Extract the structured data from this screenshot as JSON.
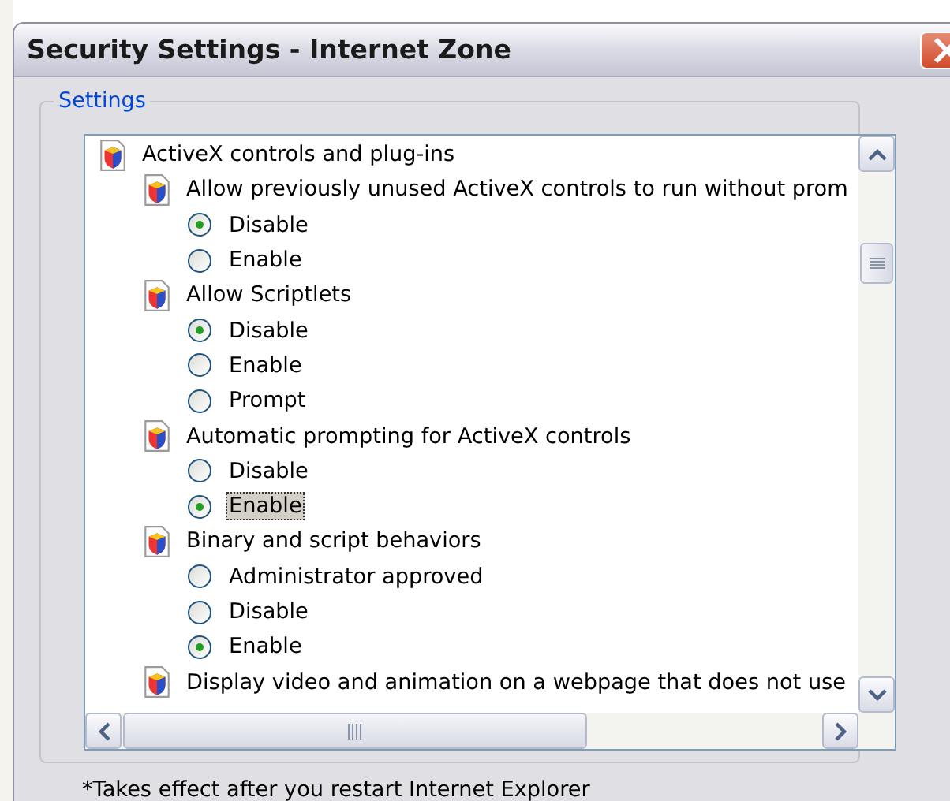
{
  "window": {
    "title": "Security Settings - Internet Zone"
  },
  "settings": {
    "label": "Settings",
    "items": [
      {
        "kind": "category",
        "label": "ActiveX controls and plug-ins",
        "children": [
          {
            "kind": "setting",
            "label": "Allow previously unused ActiveX controls to run without prom",
            "options": [
              {
                "label": "Disable",
                "selected": true,
                "focused": false
              },
              {
                "label": "Enable",
                "selected": false,
                "focused": false
              }
            ]
          },
          {
            "kind": "setting",
            "label": "Allow Scriptlets",
            "options": [
              {
                "label": "Disable",
                "selected": true,
                "focused": false
              },
              {
                "label": "Enable",
                "selected": false,
                "focused": false
              },
              {
                "label": "Prompt",
                "selected": false,
                "focused": false
              }
            ]
          },
          {
            "kind": "setting",
            "label": "Automatic prompting for ActiveX controls",
            "options": [
              {
                "label": "Disable",
                "selected": false,
                "focused": false
              },
              {
                "label": "Enable",
                "selected": true,
                "focused": true
              }
            ]
          },
          {
            "kind": "setting",
            "label": "Binary and script behaviors",
            "options": [
              {
                "label": "Administrator approved",
                "selected": false,
                "focused": false
              },
              {
                "label": "Disable",
                "selected": false,
                "focused": false
              },
              {
                "label": "Enable",
                "selected": true,
                "focused": false
              }
            ]
          },
          {
            "kind": "setting",
            "label": "Display video and animation on a webpage that does not use"
          }
        ]
      }
    ]
  },
  "note": "*Takes effect after you restart Internet Explorer"
}
